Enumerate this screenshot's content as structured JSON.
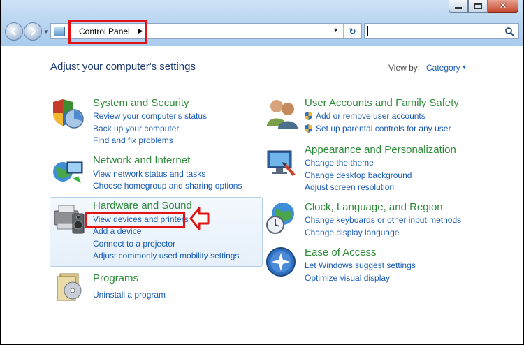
{
  "titlebar": {
    "minimize_icon": "minimize-icon",
    "maximize_icon": "maximize-icon",
    "close_glyph": "✕"
  },
  "navigation": {
    "back_icon": "back-arrow-icon",
    "forward_icon": "forward-arrow-icon",
    "address_crumb": "Control Panel",
    "refresh_glyph": "↻",
    "search_value": ""
  },
  "page": {
    "heading": "Adjust your computer's settings",
    "view_by_label": "View by:",
    "view_by_value": "Category"
  },
  "categories": {
    "system_security": {
      "title": "System and Security",
      "links": [
        "Review your computer's status",
        "Back up your computer",
        "Find and fix problems"
      ]
    },
    "network_internet": {
      "title": "Network and Internet",
      "links": [
        "View network status and tasks",
        "Choose homegroup and sharing options"
      ]
    },
    "hardware_sound": {
      "title": "Hardware and Sound",
      "links": [
        "View devices and printers",
        "Add a device",
        "Connect to a projector",
        "Adjust commonly used mobility settings"
      ]
    },
    "programs": {
      "title": "Programs",
      "links": [
        "Uninstall a program"
      ]
    },
    "user_accounts": {
      "title": "User Accounts and Family Safety",
      "links": [
        "Add or remove user accounts",
        "Set up parental controls for any user"
      ]
    },
    "appearance": {
      "title": "Appearance and Personalization",
      "links": [
        "Change the theme",
        "Change desktop background",
        "Adjust screen resolution"
      ]
    },
    "clock_language": {
      "title": "Clock, Language, and Region",
      "links": [
        "Change keyboards or other input methods",
        "Change display language"
      ]
    },
    "ease_access": {
      "title": "Ease of Access",
      "links": [
        "Let Windows suggest settings",
        "Optimize visual display"
      ]
    }
  },
  "colors": {
    "category_title": "#2d8a38",
    "link": "#1a5cb4",
    "highlight": "#e21313",
    "heading": "#1e3a6f"
  }
}
